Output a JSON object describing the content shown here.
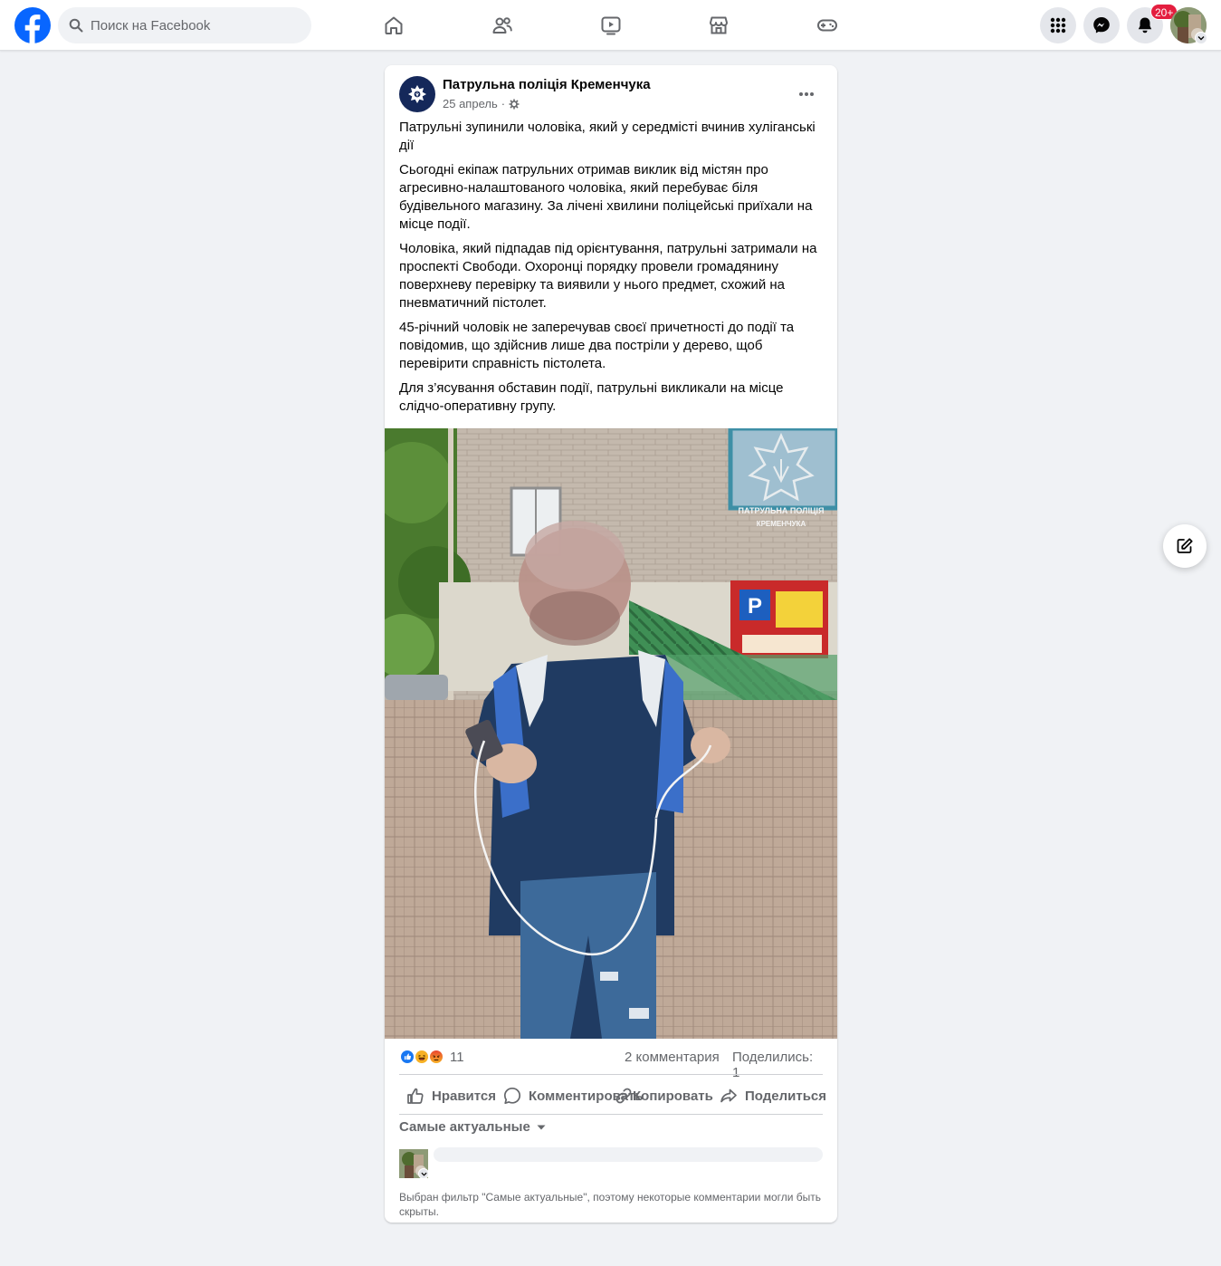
{
  "header": {
    "search_placeholder": "Поиск на Facebook",
    "notifications_badge": "20+",
    "icons": [
      "facebook-logo",
      "home-icon",
      "friends-icon",
      "watch-icon",
      "marketplace-icon",
      "gaming-icon",
      "menu-grid-icon",
      "messenger-icon",
      "bell-icon"
    ]
  },
  "post": {
    "author": "Патрульна поліція Кременчука",
    "date": "25 апрель",
    "date_separator": "·",
    "paragraphs": [
      "Патрульні зупинили чоловіка, який у середмісті вчинив хуліганські дії",
      "Сьогодні екіпаж патрульних отримав виклик від містян про агресивно-налаштованого чоловіка, який перебуває біля будівельного магазину. За лічені хвилини поліцейські приїхали на місце події.",
      "Чоловіка, який підпадав під орієнтування, патрульні затримали на проспекті Свободи. Охоронці порядку провели громадянину поверхневу перевірку та виявили у нього предмет, схожий на пневматичний пістолет.",
      "45-річний чоловік не заперечував своєї причетності до події та повідомив, що здійснив лише два постріли у дерево, щоб перевірити справність пістолета.",
      "Для з’ясування обставин події, патрульні викликали на місце слідчо-оперативну групу."
    ],
    "photo_watermark_line1": "ПАТРУЛЬНА ПОЛІЦІЯ",
    "photo_watermark_line2": "КРЕМЕНЧУКА",
    "reactions_count": "11",
    "comments_count": "2 комментария",
    "shares_count": "Поделились: 1",
    "actions": {
      "like": "Нравится",
      "comment": "Комментировать",
      "copy": "Копировать",
      "share": "Поделиться"
    },
    "sort_label": "Самые актуальные",
    "filter_note": "Выбран фильтр \"Самые актуальные\", поэтому некоторые комментарии могли быть скрыты."
  },
  "colors": {
    "brand": "#0866ff",
    "badge": "#e41e3f",
    "page_avatar": "#15285a"
  }
}
